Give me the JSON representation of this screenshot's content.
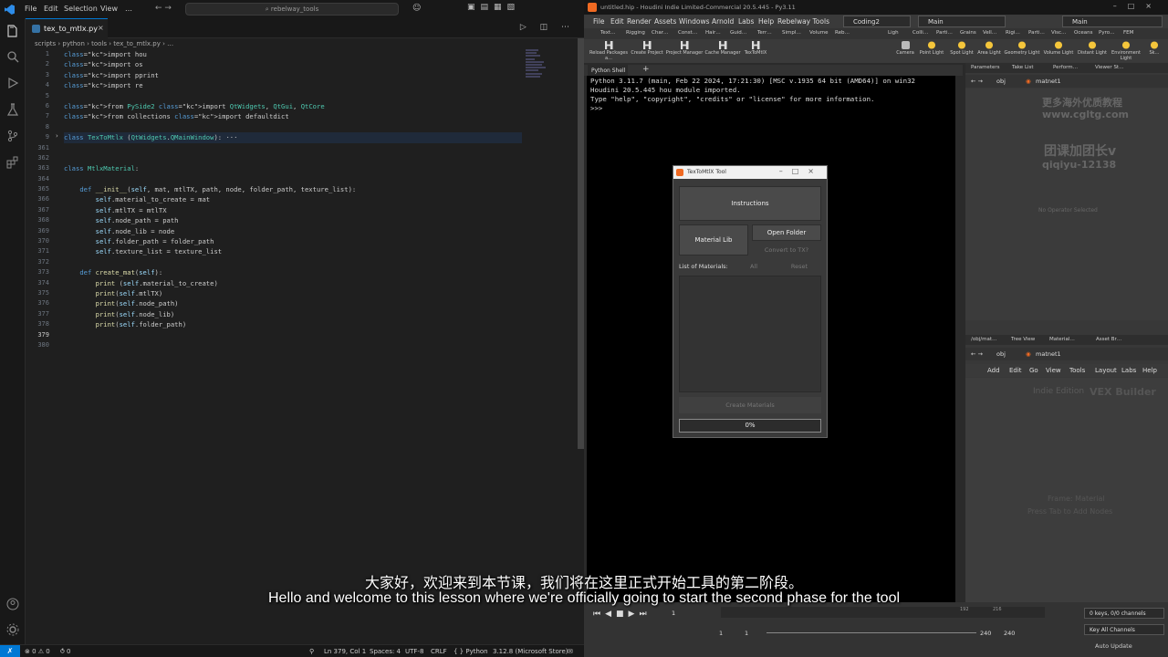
{
  "vscode": {
    "menu": [
      "File",
      "Edit",
      "Selection",
      "View",
      "…"
    ],
    "search_text": "⌕ rebelway_tools",
    "tab_label": "tex_to_mtlx.py",
    "breadcrumb": "scripts  ›  python  ›  tools  ›  tex_to_mtlx.py  ›  …",
    "line_numbers": [
      "1",
      "2",
      "3",
      "4",
      "5",
      "6",
      "7",
      "8",
      "9",
      "361",
      "362",
      "363",
      "364",
      "365",
      "366",
      "367",
      "368",
      "369",
      "370",
      "371",
      "372",
      "373",
      "374",
      "375",
      "376",
      "377",
      "378",
      "379",
      "380"
    ],
    "code_lines": [
      "import hou",
      "import os",
      "import pprint",
      "import re",
      "",
      "from PySide2 import QtWidgets, QtGui, QtCore",
      "from collections import defaultdict",
      "",
      "class TexToMtlx (QtWidgets.QMainWindow): ···",
      "",
      "",
      "class MtlxMaterial:",
      "",
      "    def __init__(self, mat, mtlTX, path, node, folder_path, texture_list):",
      "        self.material_to_create = mat",
      "        self.mtlTX = mtlTX",
      "        self.node_path = path",
      "        self.node_lib = node",
      "        self.folder_path = folder_path",
      "        self.texture_list = texture_list",
      "",
      "    def create_mat(self):",
      "        print (self.material_to_create)",
      "        print(self.mtlTX)",
      "        print(self.node_path)",
      "        print(self.node_lib)",
      "        print(self.folder_path)",
      "",
      ""
    ],
    "status": {
      "errors": "⊗ 0 ⚠ 0",
      "ports": "⥀ 0",
      "position": "Ln 379, Col 1",
      "spaces": "Spaces: 4",
      "encoding": "UTF-8",
      "eol": "CRLF",
      "language": "{ } Python",
      "interpreter": "3.12.8 (Microsoft Store)"
    }
  },
  "houdini": {
    "title": "untitled.hip - Houdini Indie Limited-Commercial 20.5.445 - Py3.11",
    "menu": [
      "File",
      "Edit",
      "Render",
      "Assets",
      "Windows",
      "Arnold",
      "Labs",
      "Help",
      "Rebelway Tools"
    ],
    "desktop": "Coding2",
    "main_left": "Main",
    "main_right": "Main",
    "shelf_tabs_left": [
      "Text…",
      "Rigging",
      "Char…",
      "Const…",
      "Hair…",
      "Guid…",
      "Terr…",
      "Simpl…",
      "Volume",
      "Reb…"
    ],
    "shelf_tabs_right": [
      "Ligh",
      "Colli…",
      "Parti…",
      "Grains",
      "Vell…",
      "Rigi…",
      "Parti…",
      "Visc…",
      "Oceans",
      "Pyro…",
      "FEM"
    ],
    "shelf_tools": [
      "Reload Packages a…",
      "Create Project",
      "Project Manager",
      "Cache Manager",
      "TexToMtlX"
    ],
    "light_tools": [
      "Camera",
      "Point Light",
      "Spot Light",
      "Area Light",
      "Geometry Light",
      "Volume Light",
      "Distant Light",
      "Environment Light",
      "Sk…"
    ],
    "shell_tab": "Python Shell",
    "shell_text": "Python 3.11.7 (main, Feb 22 2024, 17:21:30) [MSC v.1935 64 bit (AMD64)] on win32\nHoudini 20.5.445 hou module imported.\nType \"help\", \"copyright\", \"credits\" or \"license\" for more information.\n>>>",
    "param_tabs": [
      "Parameters",
      "Take List",
      "Perform…",
      "Viewer St…"
    ],
    "path_obj": "obj",
    "path_node": "matnet1",
    "no_operator": "No Operator Selected",
    "net_tabs": [
      "/obj/mat…",
      "Tree View",
      "Material…",
      "Asset Br…"
    ],
    "net_menu": [
      "Add",
      "Edit",
      "Go",
      "View",
      "Tools",
      "Layout",
      "Labs",
      "Help"
    ],
    "net_watermark": "VEX Builder",
    "net_indie": "Indie Edition",
    "net_hint_1": "Frame: Material",
    "net_hint_2": "Press Tab to Add Nodes",
    "watermark_1": "更多海外优质教程",
    "watermark_2": "www.cgltg.com",
    "watermark_3": "团课加团长v",
    "watermark_4": "qiqiyu-12138",
    "timeline": {
      "frame": "1",
      "start": "1",
      "start2": "1",
      "end": "240",
      "end2": "240",
      "tick_a": "192",
      "tick_b": "216",
      "keys": "0 keys, 0/0 channels",
      "key_all": "Key All Channels",
      "auto_update": "Auto Update"
    }
  },
  "dialog": {
    "title": "TexToMtlX Tool",
    "instructions": "Instructions",
    "material_lib": "Material Lib",
    "open_folder": "Open Folder",
    "convert": "Convert to TX?",
    "list_label": "List of Materials:",
    "all": "All",
    "reset": "Reset",
    "create": "Create Materials",
    "progress": "0%"
  },
  "subtitles": {
    "cn": "大家好，欢迎来到本节课，我们将在这里正式开始工具的第二阶段。",
    "en": "Hello and welcome to this lesson where we're officially going to start the second phase for the tool"
  }
}
